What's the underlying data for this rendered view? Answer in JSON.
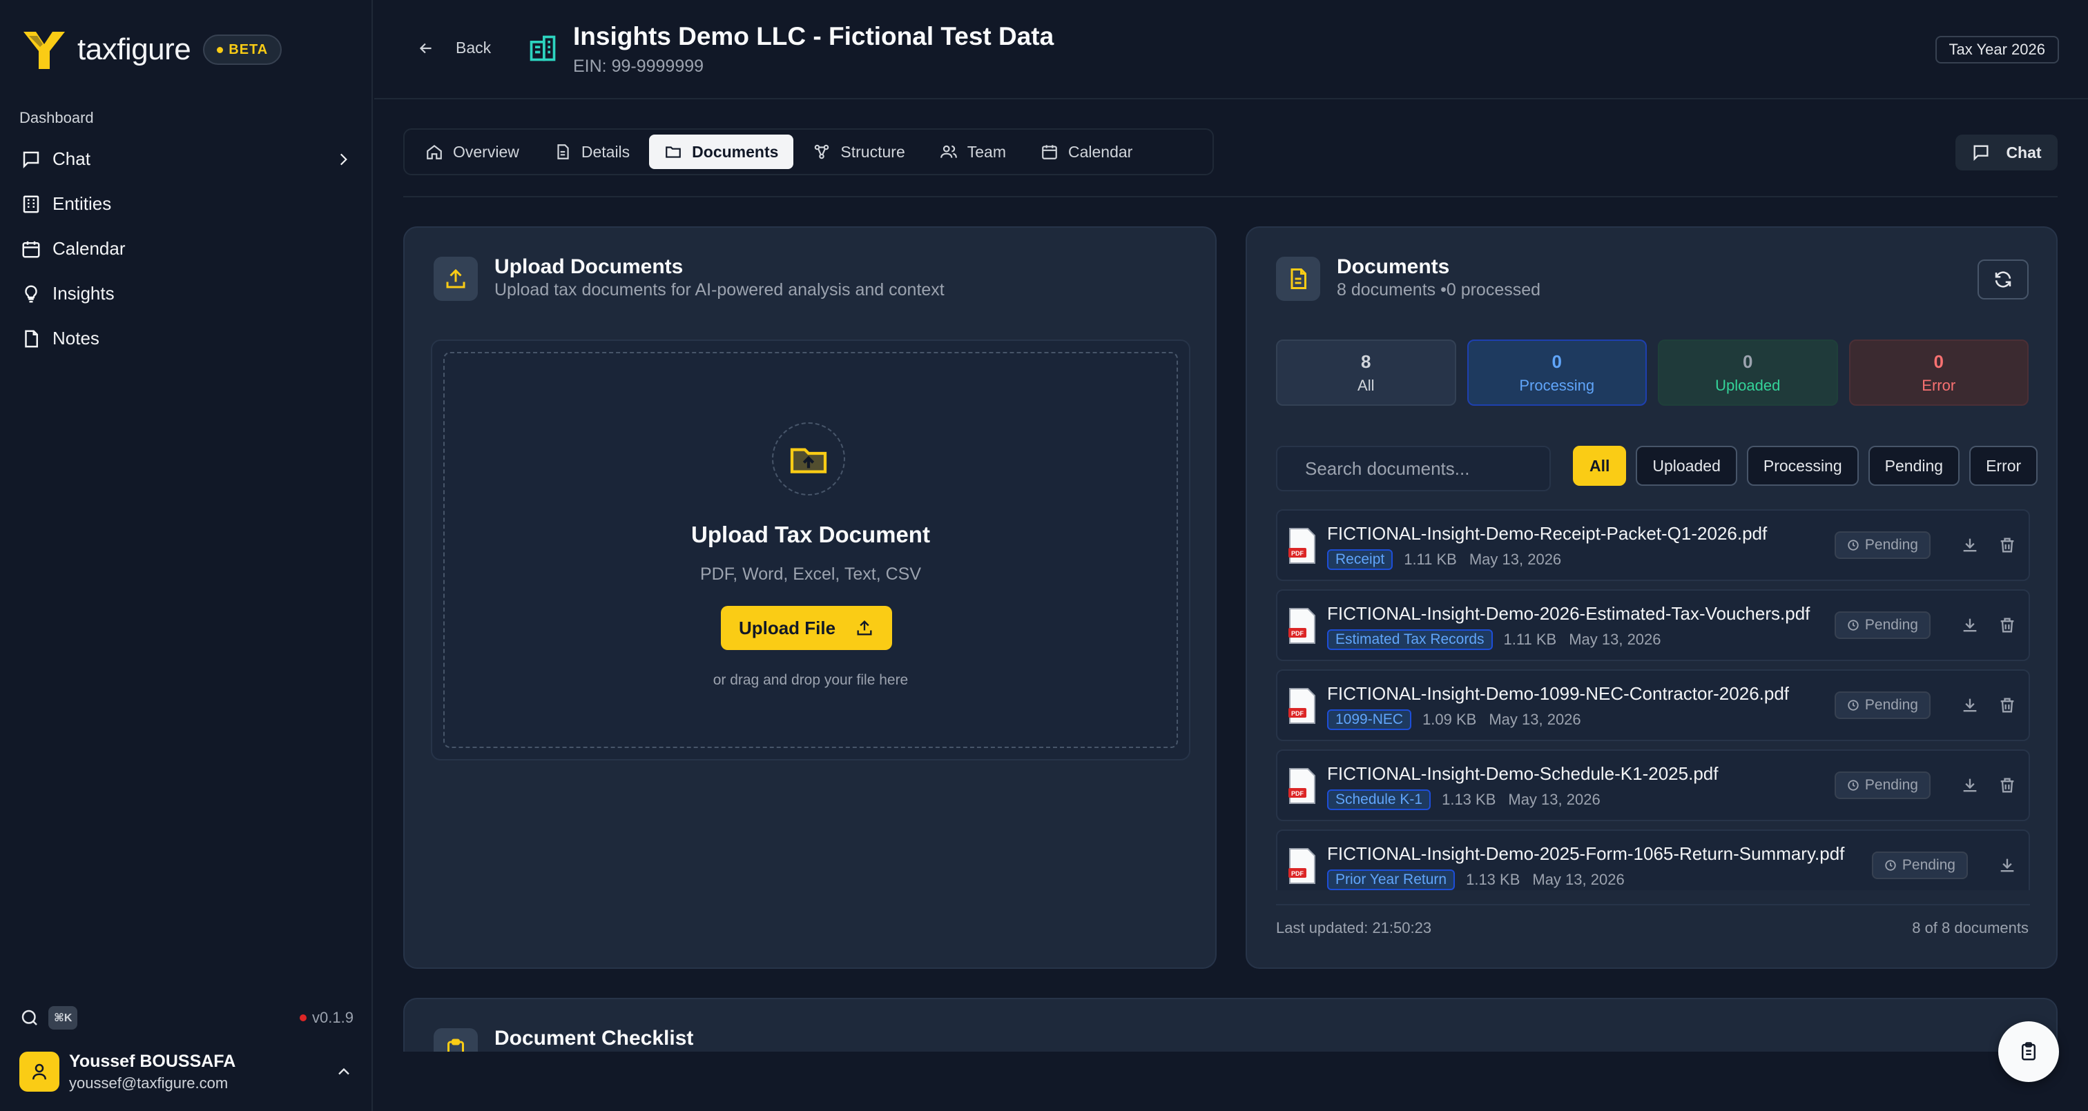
{
  "brand": {
    "name": "taxfigure",
    "badge": "BETA"
  },
  "sidebar": {
    "section": "Dashboard",
    "items": [
      {
        "label": "Chat",
        "icon": "chat-icon"
      },
      {
        "label": "Entities",
        "icon": "building-icon"
      },
      {
        "label": "Calendar",
        "icon": "calendar-icon"
      },
      {
        "label": "Insights",
        "icon": "lightbulb-icon"
      },
      {
        "label": "Notes",
        "icon": "file-icon"
      }
    ],
    "shortcut": "⌘K",
    "version": "v0.1.9",
    "user": {
      "name": "Youssef BOUSSAFA",
      "email": "youssef@taxfigure.com"
    }
  },
  "header": {
    "back_label": "Back",
    "title": "Insights Demo LLC - Fictional Test Data",
    "ein": "EIN: 99-9999999",
    "tax_year": "Tax Year 2026"
  },
  "tabs": [
    {
      "label": "Overview",
      "active": false
    },
    {
      "label": "Details",
      "active": false
    },
    {
      "label": "Documents",
      "active": true
    },
    {
      "label": "Structure",
      "active": false
    },
    {
      "label": "Team",
      "active": false
    },
    {
      "label": "Calendar",
      "active": false
    }
  ],
  "chat_button": "Chat",
  "upload": {
    "title": "Upload Documents",
    "subtitle": "Upload tax documents for AI-powered analysis and context",
    "dropzone_title": "Upload Tax Document",
    "types": "PDF, Word, Excel, Text, CSV",
    "button": "Upload File",
    "hint": "or drag and drop your file here"
  },
  "documents": {
    "title": "Documents",
    "subtitle": "8 documents •0 processed",
    "stats": [
      {
        "num": "8",
        "label": "All"
      },
      {
        "num": "0",
        "label": "Processing"
      },
      {
        "num": "0",
        "label": "Uploaded"
      },
      {
        "num": "0",
        "label": "Error"
      }
    ],
    "search_placeholder": "Search documents...",
    "filters": [
      "All",
      "Uploaded",
      "Processing",
      "Pending",
      "Error"
    ],
    "items": [
      {
        "name": "FICTIONAL-Insight-Demo-Receipt-Packet-Q1-2026.pdf",
        "tag": "Receipt",
        "size": "1.11 KB",
        "date": "May 13, 2026",
        "status": "Pending"
      },
      {
        "name": "FICTIONAL-Insight-Demo-2026-Estimated-Tax-Vouchers.pdf",
        "tag": "Estimated Tax Records",
        "size": "1.11 KB",
        "date": "May 13, 2026",
        "status": "Pending"
      },
      {
        "name": "FICTIONAL-Insight-Demo-1099-NEC-Contractor-2026.pdf",
        "tag": "1099-NEC",
        "size": "1.09 KB",
        "date": "May 13, 2026",
        "status": "Pending"
      },
      {
        "name": "FICTIONAL-Insight-Demo-Schedule-K1-2025.pdf",
        "tag": "Schedule K-1",
        "size": "1.13 KB",
        "date": "May 13, 2026",
        "status": "Pending"
      },
      {
        "name": "FICTIONAL-Insight-Demo-2025-Form-1065-Return-Summary.pdf",
        "tag": "Prior Year Return",
        "size": "1.13 KB",
        "date": "May 13, 2026",
        "status": "Pending"
      }
    ],
    "last_updated": "Last updated: 21:50:23",
    "count": "8 of 8 documents"
  },
  "checklist": {
    "title": "Document Checklist"
  },
  "colors": {
    "accent": "#facc15",
    "background": "#111827",
    "card": "#1e293b"
  }
}
